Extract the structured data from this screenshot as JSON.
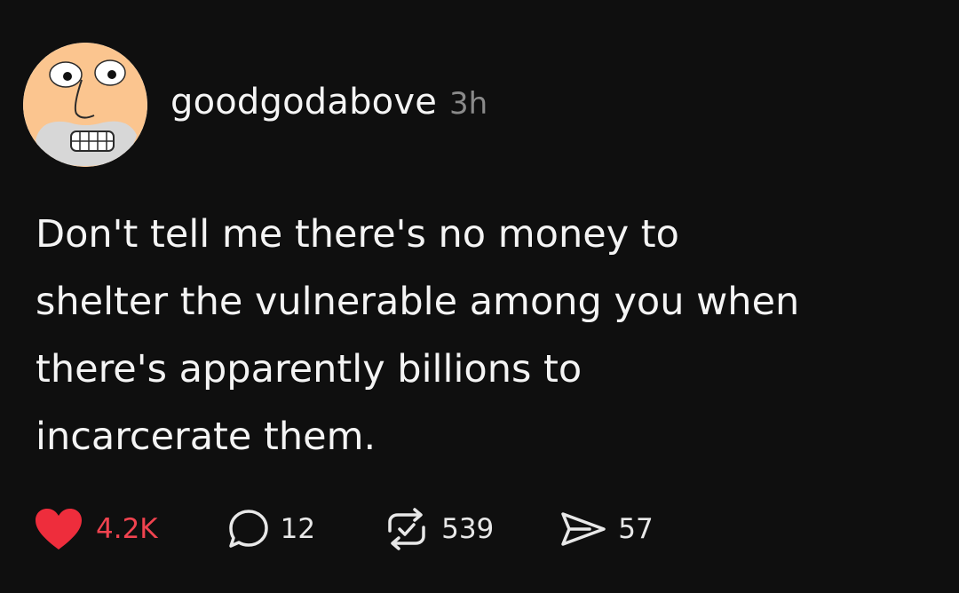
{
  "post": {
    "username": "goodgodabove",
    "timestamp": "3h",
    "text": "Don't tell me there's no money to\nshelter the vulnerable among you when\nthere's apparently billions to\nincarcerate them.",
    "avatar_icon": "cartoon-face-avatar"
  },
  "actions": {
    "like": {
      "count": "4.2K",
      "icon": "heart-icon",
      "color": "#ee2d3c",
      "liked": true
    },
    "comment": {
      "count": "12",
      "icon": "comment-icon"
    },
    "repost": {
      "count": "539",
      "icon": "repost-icon"
    },
    "share": {
      "count": "57",
      "icon": "send-icon"
    }
  },
  "colors": {
    "background": "#0f0f0f",
    "text": "#f4f4f4",
    "muted": "#8a8a8a",
    "like": "#ee2d3c"
  }
}
